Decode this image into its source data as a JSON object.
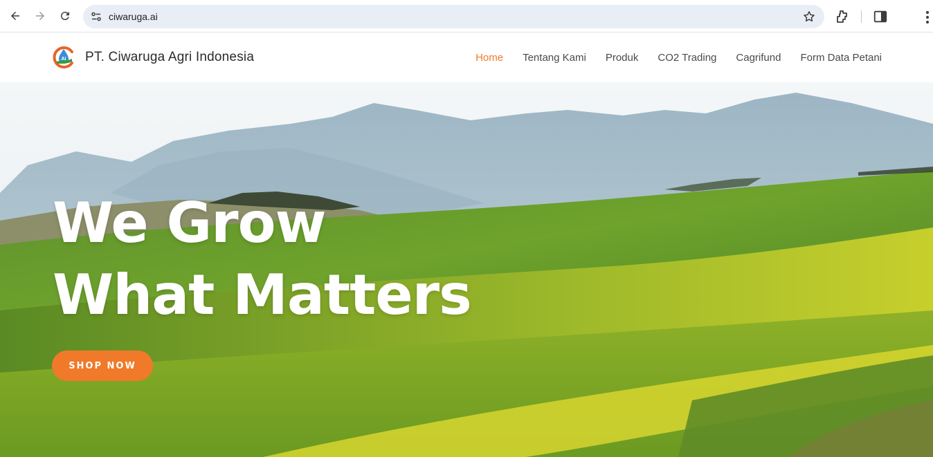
{
  "browser": {
    "url": "ciwaruga.ai",
    "icons": [
      "back-arrow-icon",
      "forward-arrow-icon",
      "reload-icon",
      "site-info-icon",
      "bookmark-star-icon",
      "extensions-icon",
      "side-panel-icon",
      "kebab-menu-icon"
    ]
  },
  "site": {
    "brand": "PT. Ciwaruga Agri Indonesia",
    "nav": [
      {
        "label": "Home",
        "active": true
      },
      {
        "label": "Tentang Kami",
        "active": false
      },
      {
        "label": "Produk",
        "active": false
      },
      {
        "label": "CO2 Trading",
        "active": false
      },
      {
        "label": "Cagrifund",
        "active": false
      },
      {
        "label": "Form Data Petani",
        "active": false
      }
    ]
  },
  "hero": {
    "title_line1": "We Grow",
    "title_line2": "What Matters",
    "cta_label": "SHOP NOW"
  },
  "colors": {
    "accent": "#f07a2a",
    "nav_text": "#4a4a4a",
    "omnibox": "#e9eef6"
  }
}
